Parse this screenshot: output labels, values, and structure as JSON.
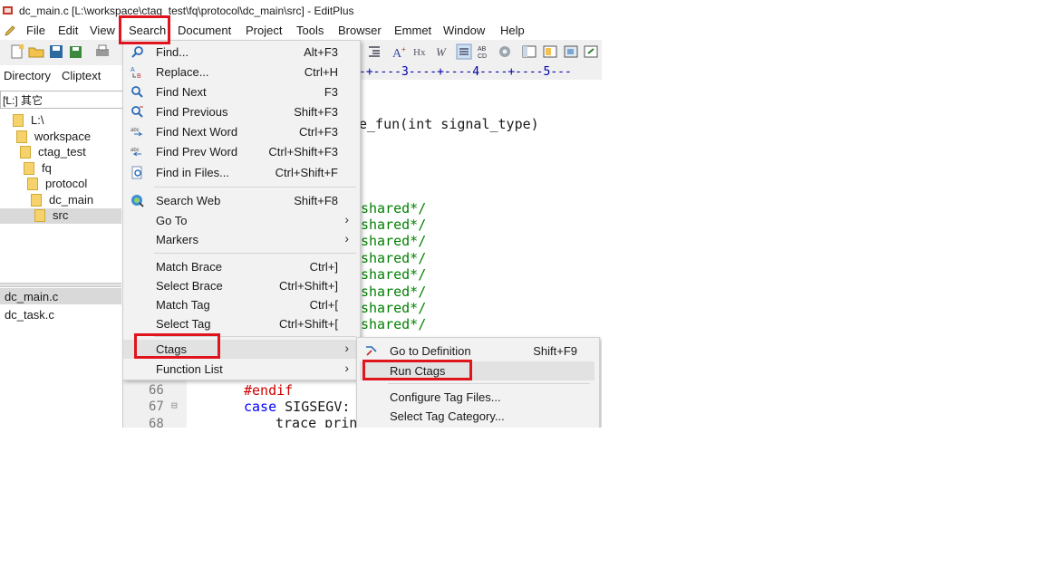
{
  "window": {
    "title": "dc_main.c [L:\\workspace\\ctag_test\\fq\\protocol\\dc_main\\src] - EditPlus"
  },
  "menubar": {
    "items": [
      "File",
      "Edit",
      "View",
      "Search",
      "Document",
      "Project",
      "Tools",
      "Browser",
      "Emmet",
      "Window",
      "Help"
    ]
  },
  "left_panel": {
    "tabs": [
      "Directory",
      "Cliptext"
    ],
    "drive": "[L:] 其它",
    "tree": [
      "L:\\",
      "workspace",
      "ctag_test",
      "fq",
      "protocol",
      "dc_main",
      "src"
    ],
    "files": [
      "dc_main.c",
      "dc_task.c"
    ]
  },
  "editor": {
    "ruler": "-+----3----+----4----+----5---",
    "line_func": "e_fun(int signal_type)",
    "brace": ")",
    "shared_lines": [
      "shared*/",
      "shared*/",
      "shared*/",
      "shared*/",
      "shared*/",
      "shared*/",
      "shared*/",
      "shared*/"
    ],
    "lines": [
      {
        "num": "66",
        "text": "#endif"
      },
      {
        "num": "67",
        "kw": "case",
        "rest": " SIGSEGV:"
      },
      {
        "num": "68",
        "text": "trace_prin"
      }
    ]
  },
  "search_menu": {
    "items": [
      {
        "label": "Find...",
        "shortcut": "Alt+F3",
        "icon": "find-icon"
      },
      {
        "label": "Replace...",
        "shortcut": "Ctrl+H",
        "icon": "replace-icon"
      },
      {
        "label": "Find Next",
        "shortcut": "F3",
        "icon": "find-next-icon"
      },
      {
        "label": "Find Previous",
        "shortcut": "Shift+F3",
        "icon": "find-previous-icon"
      },
      {
        "label": "Find Next Word",
        "shortcut": "Ctrl+F3",
        "icon": "find-next-word-icon"
      },
      {
        "label": "Find Prev Word",
        "shortcut": "Ctrl+Shift+F3",
        "icon": "find-prev-word-icon"
      },
      {
        "label": "Find in Files...",
        "shortcut": "Ctrl+Shift+F",
        "icon": "find-in-files-icon"
      },
      {
        "label": "Search Web",
        "shortcut": "Shift+F8",
        "icon": "search-web-icon"
      },
      {
        "label": "Go To",
        "shortcut": "",
        "submenu": true
      },
      {
        "label": "Markers",
        "shortcut": "",
        "submenu": true
      },
      {
        "label": "Match Brace",
        "shortcut": "Ctrl+]"
      },
      {
        "label": "Select Brace",
        "shortcut": "Ctrl+Shift+]"
      },
      {
        "label": "Match Tag",
        "shortcut": "Ctrl+["
      },
      {
        "label": "Select Tag",
        "shortcut": "Ctrl+Shift+["
      },
      {
        "label": "Ctags",
        "shortcut": "",
        "submenu": true
      },
      {
        "label": "Function List",
        "shortcut": "",
        "submenu": true
      }
    ]
  },
  "ctags_submenu": {
    "items": [
      {
        "label": "Go to Definition",
        "shortcut": "Shift+F9",
        "icon": "go-to-definition-icon"
      },
      {
        "label": "Run Ctags",
        "shortcut": ""
      },
      {
        "label": "Configure Tag Files...",
        "shortcut": ""
      },
      {
        "label": "Select Tag Category...",
        "shortcut": ""
      }
    ]
  },
  "colors": {
    "highlight": "#e0141d",
    "menu_bg": "#f2f2f2",
    "code_green": "#008000",
    "code_blue": "#0000ff",
    "code_red": "#d00000"
  }
}
